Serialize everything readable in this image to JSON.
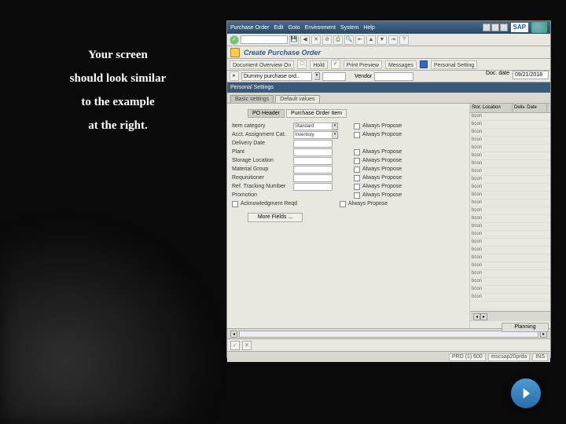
{
  "slide": {
    "text_l1": "Your screen",
    "text_l2": "should look similar",
    "text_l3": "to the example",
    "text_l4": "at the right."
  },
  "menubar": [
    "Purchase Order",
    "Edit",
    "Goto",
    "Environment",
    "System",
    "Help"
  ],
  "sap_logo": "SAP",
  "screen_title": "Create Purchase Order",
  "apptoolbar": {
    "doc_overview": "Document Overview On",
    "hold": "Hold",
    "print_preview": "Print Preview",
    "messages": "Messages",
    "personal_setting": "Personal Setting"
  },
  "header": {
    "doc_type": "Dummy purchase ord..",
    "vendor_lbl": "Vendor",
    "vendor": "",
    "docdate_lbl": "Doc. date",
    "docdate": "09/21/2018"
  },
  "dialog_title": "Personal Settings",
  "tabs": {
    "t1": "Basic settings",
    "t2": "Default values"
  },
  "subtabs": {
    "s1": "PO Header",
    "s2": "Purchase Order Item"
  },
  "fields": {
    "item_cat_lbl": "Item category",
    "item_cat_val": "Standard",
    "acct_lbl": "Acct. Assignment Cat.",
    "acct_val": "Inventory",
    "deliv_lbl": "Delivery Date",
    "plant_lbl": "Plant",
    "sloc_lbl": "Storage Location",
    "matgrp_lbl": "Material Group",
    "req_lbl": "Requisitioner",
    "track_lbl": "Ref. Tracking Number",
    "promo_lbl": "Promotion",
    "ack_lbl": "Acknowledgment Reqd",
    "always": "Always Propose",
    "more": "More Fields ..."
  },
  "rightcols": {
    "c1": "Stor. Location",
    "c2": "Deliv. Date",
    "cell": "bcon"
  },
  "footer": {
    "planning": "Planning"
  },
  "status": {
    "sys": "PRD (1) 600",
    "srv": "eiscsap20prda",
    "ins": "INS"
  }
}
